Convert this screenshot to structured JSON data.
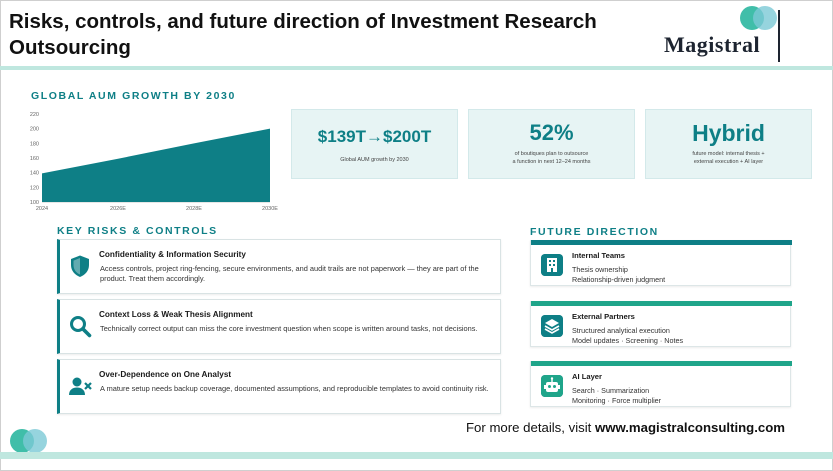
{
  "header": {
    "title": "Risks, controls, and future direction of Investment Research Outsourcing",
    "logo_text": "Magistral"
  },
  "colors": {
    "accent": "#0e7f86",
    "accent_green": "#1fa58a",
    "card_bg": "#e7f4f4",
    "rule": "#bfe7df"
  },
  "aum_section": {
    "label": "GLOBAL AUM GROWTH BY 2030"
  },
  "chart_data": {
    "type": "area",
    "title": "",
    "xlabel": "",
    "ylabel": "",
    "x": [
      "2024",
      "2026E",
      "2028E",
      "2030E"
    ],
    "y_ticks": [
      "100",
      "120",
      "140",
      "160",
      "180",
      "200",
      "220"
    ],
    "series": [
      {
        "values": [
          139,
          159,
          180,
          200
        ]
      }
    ],
    "ylim": [
      100,
      220
    ],
    "grid": false,
    "legend": "none",
    "color": "#0e7f86"
  },
  "kpis": [
    {
      "value": "$139T→$200T",
      "caption": "Global AUM growth by 2030"
    },
    {
      "value": "52%",
      "caption": "of boutiques plan to outsource\na function in next 12–24 months"
    },
    {
      "value": "Hybrid",
      "caption": "future model: internal thesis +\nexternal execution + AI layer"
    }
  ],
  "risks_section": {
    "label": "KEY RISKS & CONTROLS",
    "items": [
      {
        "icon": "shield-icon",
        "title": "Confidentiality & Information Security",
        "desc": "Access controls, project ring-fencing, secure environments, and audit trails are not paperwork — they are part of the product. Treat them accordingly."
      },
      {
        "icon": "magnifier-icon",
        "title": "Context Loss & Weak Thesis Alignment",
        "desc": "Technically correct output can miss the core investment question when scope is written around tasks, not decisions."
      },
      {
        "icon": "person-remove-icon",
        "title": "Over-Dependence on One Analyst",
        "desc": "A mature setup needs backup coverage, documented assumptions, and reproducible templates to avoid continuity risk."
      }
    ]
  },
  "future_section": {
    "label": "FUTURE DIRECTION",
    "items": [
      {
        "icon": "building-icon",
        "title": "Internal Teams",
        "line1": "Thesis ownership",
        "line2": "Relationship-driven judgment"
      },
      {
        "icon": "layers-icon",
        "title": "External Partners",
        "line1": "Structured analytical execution",
        "line2": "Model updates · Screening · Notes"
      },
      {
        "icon": "robot-icon",
        "title": "AI Layer",
        "line1": "Search · Summarization",
        "line2": "Monitoring · Force multiplier"
      }
    ]
  },
  "footer": {
    "prefix": "For more details, visit ",
    "url": "www.magistralconsulting.com"
  }
}
